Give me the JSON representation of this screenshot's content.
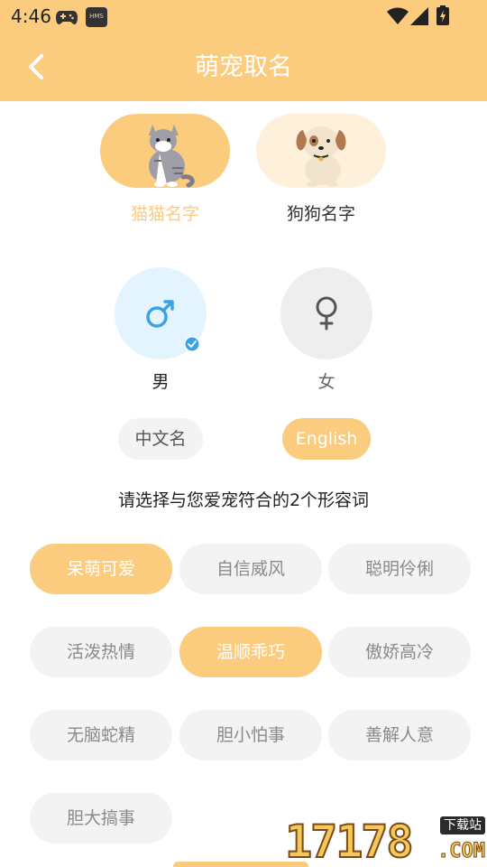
{
  "status_bar": {
    "time": "4:46",
    "hms_label": "HMS"
  },
  "header": {
    "title": "萌宠取名"
  },
  "pet_types": [
    {
      "label": "猫猫名字",
      "selected": true
    },
    {
      "label": "狗狗名字",
      "selected": false
    }
  ],
  "genders": [
    {
      "label": "男",
      "symbol": "♂",
      "selected": true
    },
    {
      "label": "女",
      "symbol": "♀",
      "selected": false
    }
  ],
  "languages": [
    {
      "label": "中文名",
      "selected": false
    },
    {
      "label": "English",
      "selected": true
    }
  ],
  "prompt": "请选择与您爱宠符合的2个形容词",
  "adjectives": [
    {
      "label": "呆萌可爱",
      "selected": true
    },
    {
      "label": "自信威风",
      "selected": false
    },
    {
      "label": "聪明伶俐",
      "selected": false
    },
    {
      "label": "活泼热情",
      "selected": false
    },
    {
      "label": "温顺乖巧",
      "selected": true
    },
    {
      "label": "傲娇高冷",
      "selected": false
    },
    {
      "label": "无脑蛇精",
      "selected": false
    },
    {
      "label": "胆小怕事",
      "selected": false
    },
    {
      "label": "善解人意",
      "selected": false
    },
    {
      "label": "胆大搞事",
      "selected": false
    }
  ],
  "watermark": {
    "number": "17178",
    "badge": "下载站",
    "suffix": ".COM"
  },
  "colors": {
    "accent": "#FBCB7E",
    "accent_light": "#FFF0DC",
    "male_bg": "#E4F4FE",
    "male_symbol": "#3AA3E6",
    "female_bg": "#EEEEEE"
  }
}
